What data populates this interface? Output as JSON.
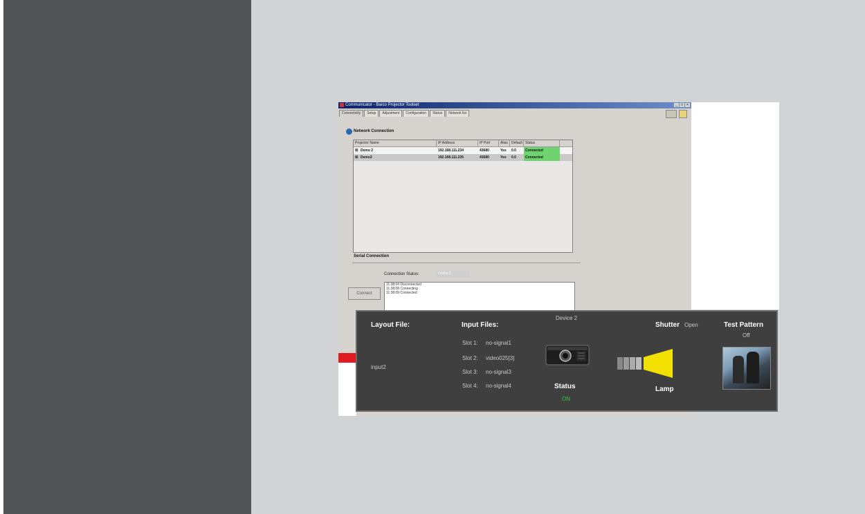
{
  "app": {
    "window_title": "Communicator - Barco Projector Toolset",
    "tabs": [
      "Connectivity",
      "Setup",
      "Adjustment",
      "Configuration",
      "Status",
      "Network list"
    ],
    "network_connection_label": "Network Connection",
    "table": {
      "headers": [
        "Projector Name",
        "IP Address",
        "IP Port",
        "Alias",
        "Default",
        "Status"
      ],
      "rows": [
        {
          "check": "☒",
          "name": "Demo 2",
          "ip": "192.168.111.234",
          "port": "43680",
          "alias": "Yes",
          "default": "0.0",
          "status": "Connected"
        },
        {
          "check": "☒",
          "name": "Demo3",
          "ip": "192.168.111.235",
          "port": "43680",
          "alias": "Yes",
          "default": "0.0",
          "status": "Connected"
        }
      ]
    },
    "serial_connection_label": "Serial Connection",
    "connection_status_label": "Connection Status:",
    "connection_status_value": "Online 2",
    "log_lines": [
      "11:38:04 Disconnected",
      "11:38:08 Connecting",
      "11:38:09 Connected"
    ],
    "connect_button": "Connect"
  },
  "panel": {
    "layout_file_label": "Layout File:",
    "layout_file_value": "input2",
    "input_files_label": "Input Files:",
    "slots": [
      {
        "slot": "Slot 1:",
        "value": "no-signal1"
      },
      {
        "slot": "Slot 2:",
        "value": "video025[3]"
      },
      {
        "slot": "Slot 3:",
        "value": "no-signal3"
      },
      {
        "slot": "Slot 4:",
        "value": "no-signal4"
      }
    ],
    "device_name": "Device 2",
    "status_label": "Status",
    "status_value": "ON",
    "status_color": "#2ecc40",
    "shutter_label": "Shutter",
    "shutter_value": "Open",
    "lamp_label": "Lamp",
    "lamp_color": "#f2e100",
    "test_pattern_label": "Test Pattern",
    "test_pattern_value": "Off"
  }
}
